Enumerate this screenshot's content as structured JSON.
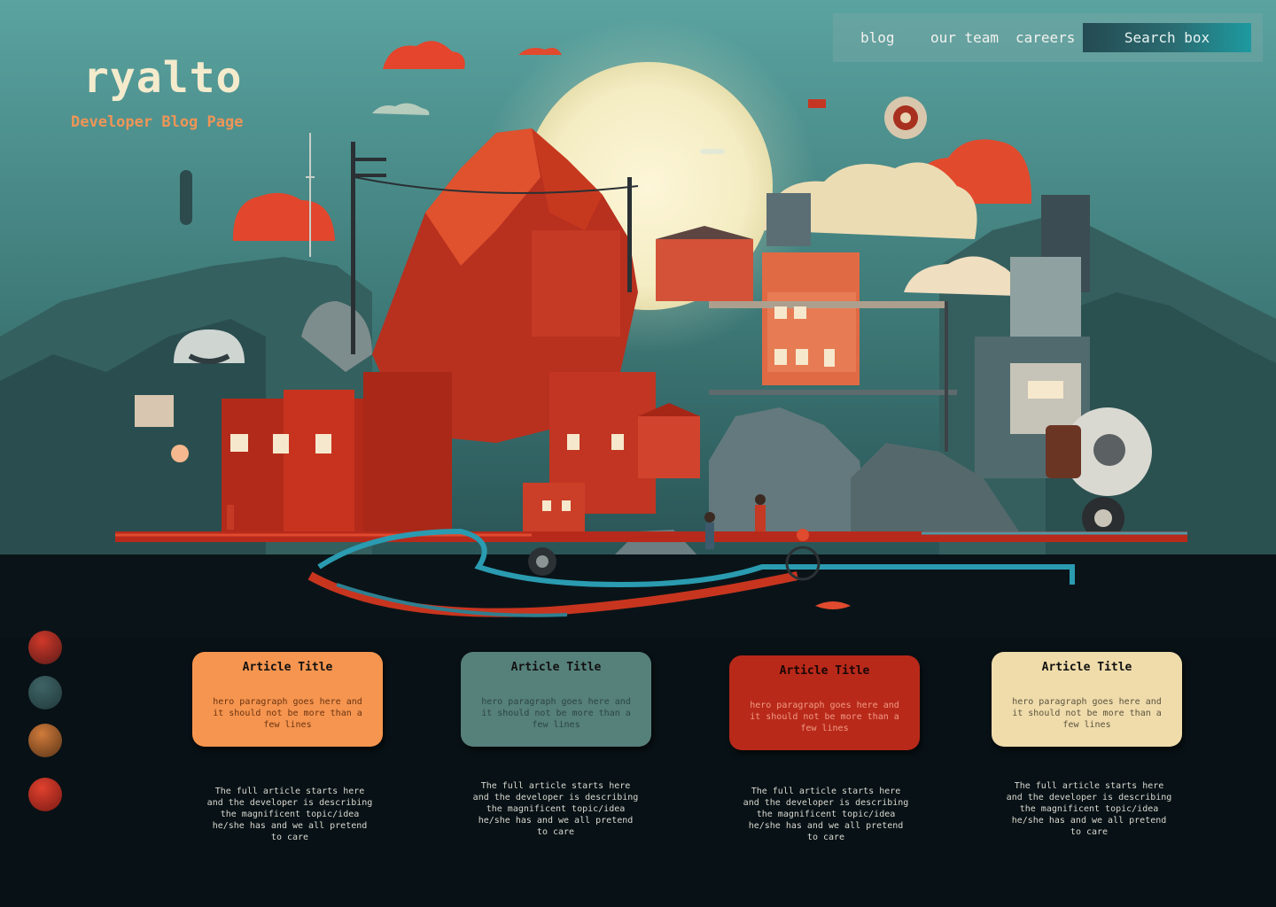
{
  "brand": {
    "title": "ryalto",
    "subtitle": "Developer Blog Page"
  },
  "nav": {
    "links": [
      "blog",
      "our team",
      "careers"
    ],
    "search_placeholder": "Search box"
  },
  "palette": [
    "#b42d22",
    "#2f4c4e",
    "#a85d28",
    "#c9301f"
  ],
  "articles": [
    {
      "title": "Article Title",
      "hero": "hero paragraph goes here and it should not be more than a few lines",
      "excerpt": "The full article starts here and the developer is describing the magnificent topic/idea he/she has and we all pretend to care",
      "color": "#f6954f"
    },
    {
      "title": "Article Title",
      "hero": "hero paragraph goes here and it should not be more than a few lines",
      "excerpt": "The full article starts here and the developer is describing the magnificent topic/idea he/she has and we all pretend to care",
      "color": "#56807a"
    },
    {
      "title": "Article Title",
      "hero": "hero paragraph goes here and it should not be more than a few lines",
      "excerpt": "The full article starts here and the developer is describing the magnificent topic/idea he/she has and we all pretend to care",
      "color": "#b8291a"
    },
    {
      "title": "Article Title",
      "hero": "hero paragraph goes here and it should not be more than a few lines",
      "excerpt": "The full article starts here and the developer is describing the magnificent topic/idea he/she has and we all pretend to care",
      "color": "#efdcaa"
    }
  ]
}
